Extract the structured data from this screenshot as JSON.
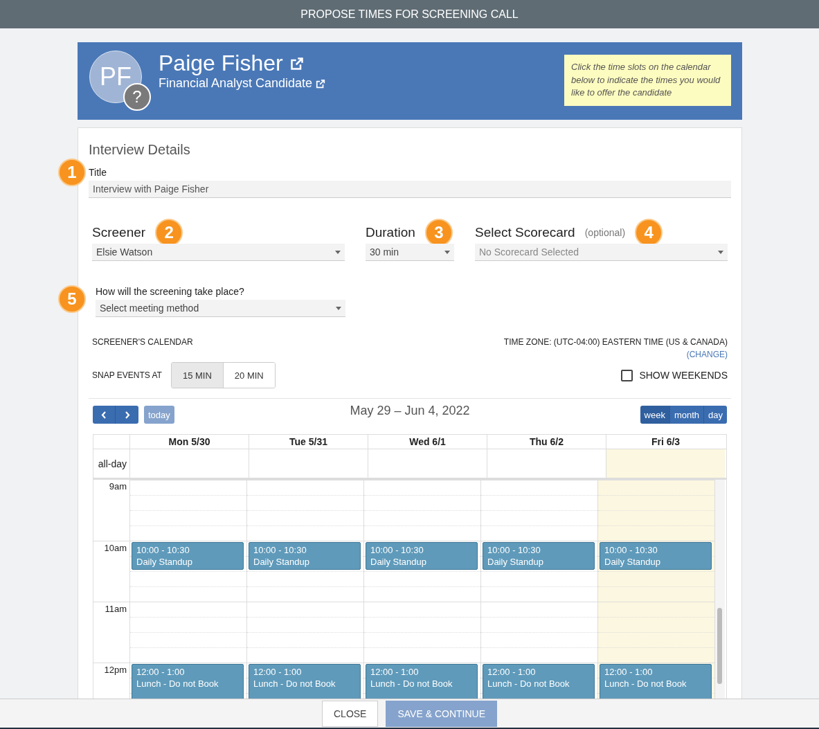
{
  "window": {
    "title": "PROPOSE TIMES FOR SCREENING CALL"
  },
  "candidate": {
    "initials": "PF",
    "badge": "?",
    "name": "Paige Fisher",
    "role": "Financial Analyst Candidate",
    "hint": "Click the time slots on the calendar below to indicate the times you would like to offer the candidate"
  },
  "details": {
    "heading": "Interview Details",
    "title_field": {
      "marker": "1",
      "label": "Title",
      "value": "Interview with Paige Fisher"
    },
    "screener": {
      "marker": "2",
      "label": "Screener",
      "value": "Elsie Watson"
    },
    "duration": {
      "marker": "3",
      "label": "Duration",
      "value": "30 min"
    },
    "scorecard": {
      "marker": "4",
      "label": "Select Scorecard",
      "note": "(optional)",
      "placeholder": "No Scorecard Selected"
    },
    "meeting": {
      "marker": "5",
      "label": "How will the screening take place?",
      "placeholder": "Select meeting method"
    }
  },
  "calendar": {
    "heading": "SCREENER'S CALENDAR",
    "time_zone": "TIME ZONE: (UTC-04:00) EASTERN TIME (US & CANADA)",
    "change_link": "(CHANGE)",
    "snap_label": "SNAP EVENTS AT",
    "snap_options": [
      {
        "label": "15 MIN",
        "selected": true
      },
      {
        "label": "20 MIN",
        "selected": false
      }
    ],
    "show_weekends": {
      "label": "SHOW WEEKENDS",
      "checked": false
    },
    "range": "May 29 – Jun 4, 2022",
    "today_button": "today",
    "views": [
      {
        "label": "week",
        "selected": true
      },
      {
        "label": "month",
        "selected": false
      },
      {
        "label": "day",
        "selected": false
      }
    ],
    "allday_label": "all-day",
    "days": [
      {
        "label": "Mon 5/30",
        "today": false
      },
      {
        "label": "Tue 5/31",
        "today": false
      },
      {
        "label": "Wed 6/1",
        "today": false
      },
      {
        "label": "Thu 6/2",
        "today": false
      },
      {
        "label": "Fri 6/3",
        "today": true
      }
    ],
    "hours": [
      {
        "label": "9am"
      },
      {
        "label": "10am",
        "events": [
          {
            "time": "10:00 - 10:30",
            "title": "Daily Standup",
            "kind": "half"
          },
          {
            "time": "10:00 - 10:30",
            "title": "Daily Standup",
            "kind": "half"
          },
          {
            "time": "10:00 - 10:30",
            "title": "Daily Standup",
            "kind": "half"
          },
          {
            "time": "10:00 - 10:30",
            "title": "Daily Standup",
            "kind": "half"
          },
          {
            "time": "10:00 - 10:30",
            "title": "Daily Standup",
            "kind": "half"
          }
        ]
      },
      {
        "label": "11am"
      },
      {
        "label": "12pm",
        "events": [
          {
            "time": "12:00 - 1:00",
            "title": "Lunch - Do not Book",
            "kind": "hour"
          },
          {
            "time": "12:00 - 1:00",
            "title": "Lunch - Do not Book",
            "kind": "hour"
          },
          {
            "time": "12:00 - 1:00",
            "title": "Lunch - Do not Book",
            "kind": "hour"
          },
          {
            "time": "12:00 - 1:00",
            "title": "Lunch - Do not Book",
            "kind": "hour"
          },
          {
            "time": "12:00 - 1:00",
            "title": "Lunch - Do not Book",
            "kind": "hour"
          }
        ]
      }
    ]
  },
  "footer": {
    "buttons": [
      {
        "label": "CLOSE",
        "kind": "secondary"
      },
      {
        "label": "SAVE & CONTINUE",
        "kind": "primary"
      }
    ]
  }
}
